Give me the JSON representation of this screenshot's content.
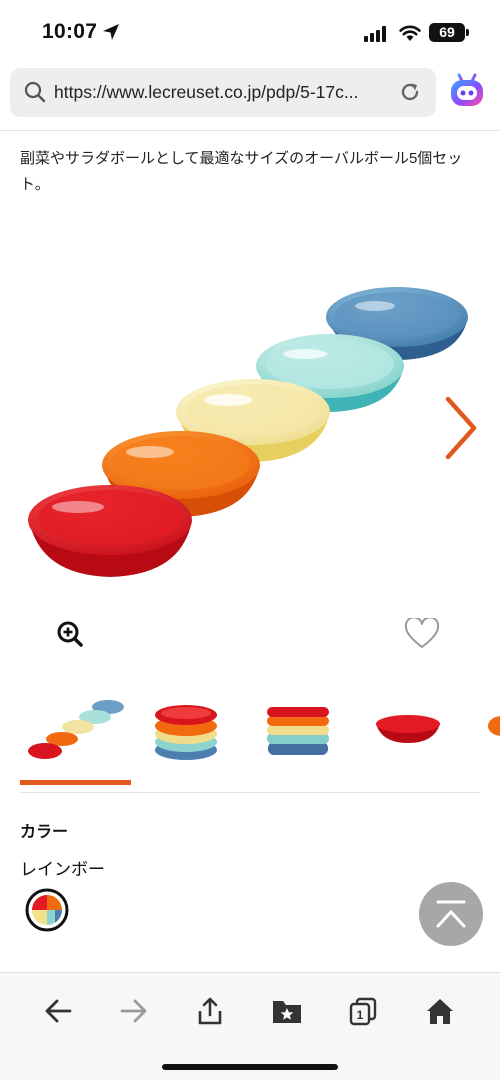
{
  "status_bar": {
    "time": "10:07",
    "battery": "69"
  },
  "browser": {
    "url": "https://www.lecreuset.co.jp/pdp/5-17c..."
  },
  "product": {
    "description": "副菜やサラダボールとして最適なサイズのオーバルボール5個セット。",
    "color_heading": "カラー",
    "color_value": "レインボー"
  },
  "colors": {
    "accent": "#e2571b",
    "bowls": [
      "#d8141f",
      "#f26a10",
      "#f5e3a0",
      "#9fdcd6",
      "#5a95c0"
    ]
  },
  "icons": {
    "location": "location-arrow-icon",
    "signal": "signal-icon",
    "wifi": "wifi-icon",
    "search": "search-icon",
    "reload": "reload-icon",
    "assistant": "assistant-bot-icon",
    "zoom": "zoom-in-icon",
    "favorite": "heart-icon",
    "next": "chevron-right-icon",
    "scroll_top": "scroll-to-top-icon",
    "back": "arrow-left-icon",
    "forward": "arrow-right-icon",
    "share": "share-icon",
    "bookmarks": "bookmark-folder-icon",
    "tabs": "tabs-icon",
    "home": "home-icon"
  },
  "toolbar": {
    "tab_count": "1"
  }
}
